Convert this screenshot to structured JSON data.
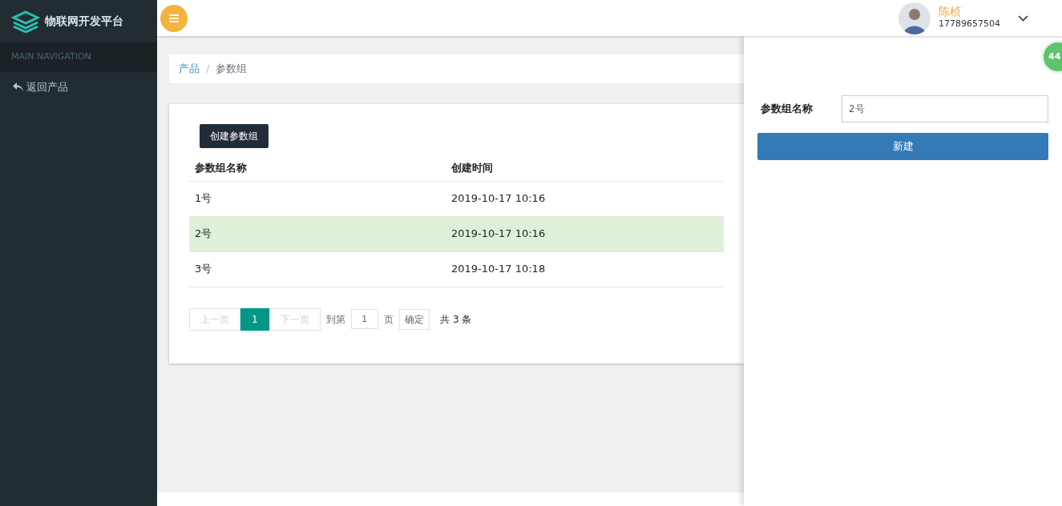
{
  "sidebar": {
    "logo_text": "物联网开发平台",
    "section_header": "MAIN NAVIGATION",
    "items": [
      {
        "label": "返回产品",
        "selected": false
      }
    ]
  },
  "header": {
    "user": {
      "name": "陈桢",
      "phone": "17789657504"
    }
  },
  "breadcrumb": {
    "separator": "/",
    "items": [
      {
        "label": "产品",
        "link": true
      },
      {
        "label": "参数组",
        "link": false
      }
    ]
  },
  "create_button": "创建参数组",
  "table": {
    "columns": [
      "参数组名称",
      "创建时间"
    ],
    "rows": [
      {
        "cells": [
          "1号",
          "2019-10-17 10:16"
        ],
        "selected": false
      },
      {
        "cells": [
          "2号",
          "2019-10-17 10:16"
        ],
        "selected": true
      },
      {
        "cells": [
          "3号",
          "2019-10-17 10:18"
        ],
        "selected": false
      }
    ]
  },
  "pagination": {
    "prev": {
      "label": "上一页",
      "disabled": true
    },
    "pages": [
      {
        "label": "1",
        "selected": true
      }
    ],
    "next": {
      "label": "下一页",
      "disabled": true
    },
    "goto_label": "到第",
    "goto_value": "1",
    "page_unit": "页",
    "confirm": "确定",
    "total": "共 3 条"
  },
  "side_panel": {
    "field_label": "参数组名称",
    "field_value": "2号",
    "submit": "新建"
  },
  "floating_badge": "44"
}
